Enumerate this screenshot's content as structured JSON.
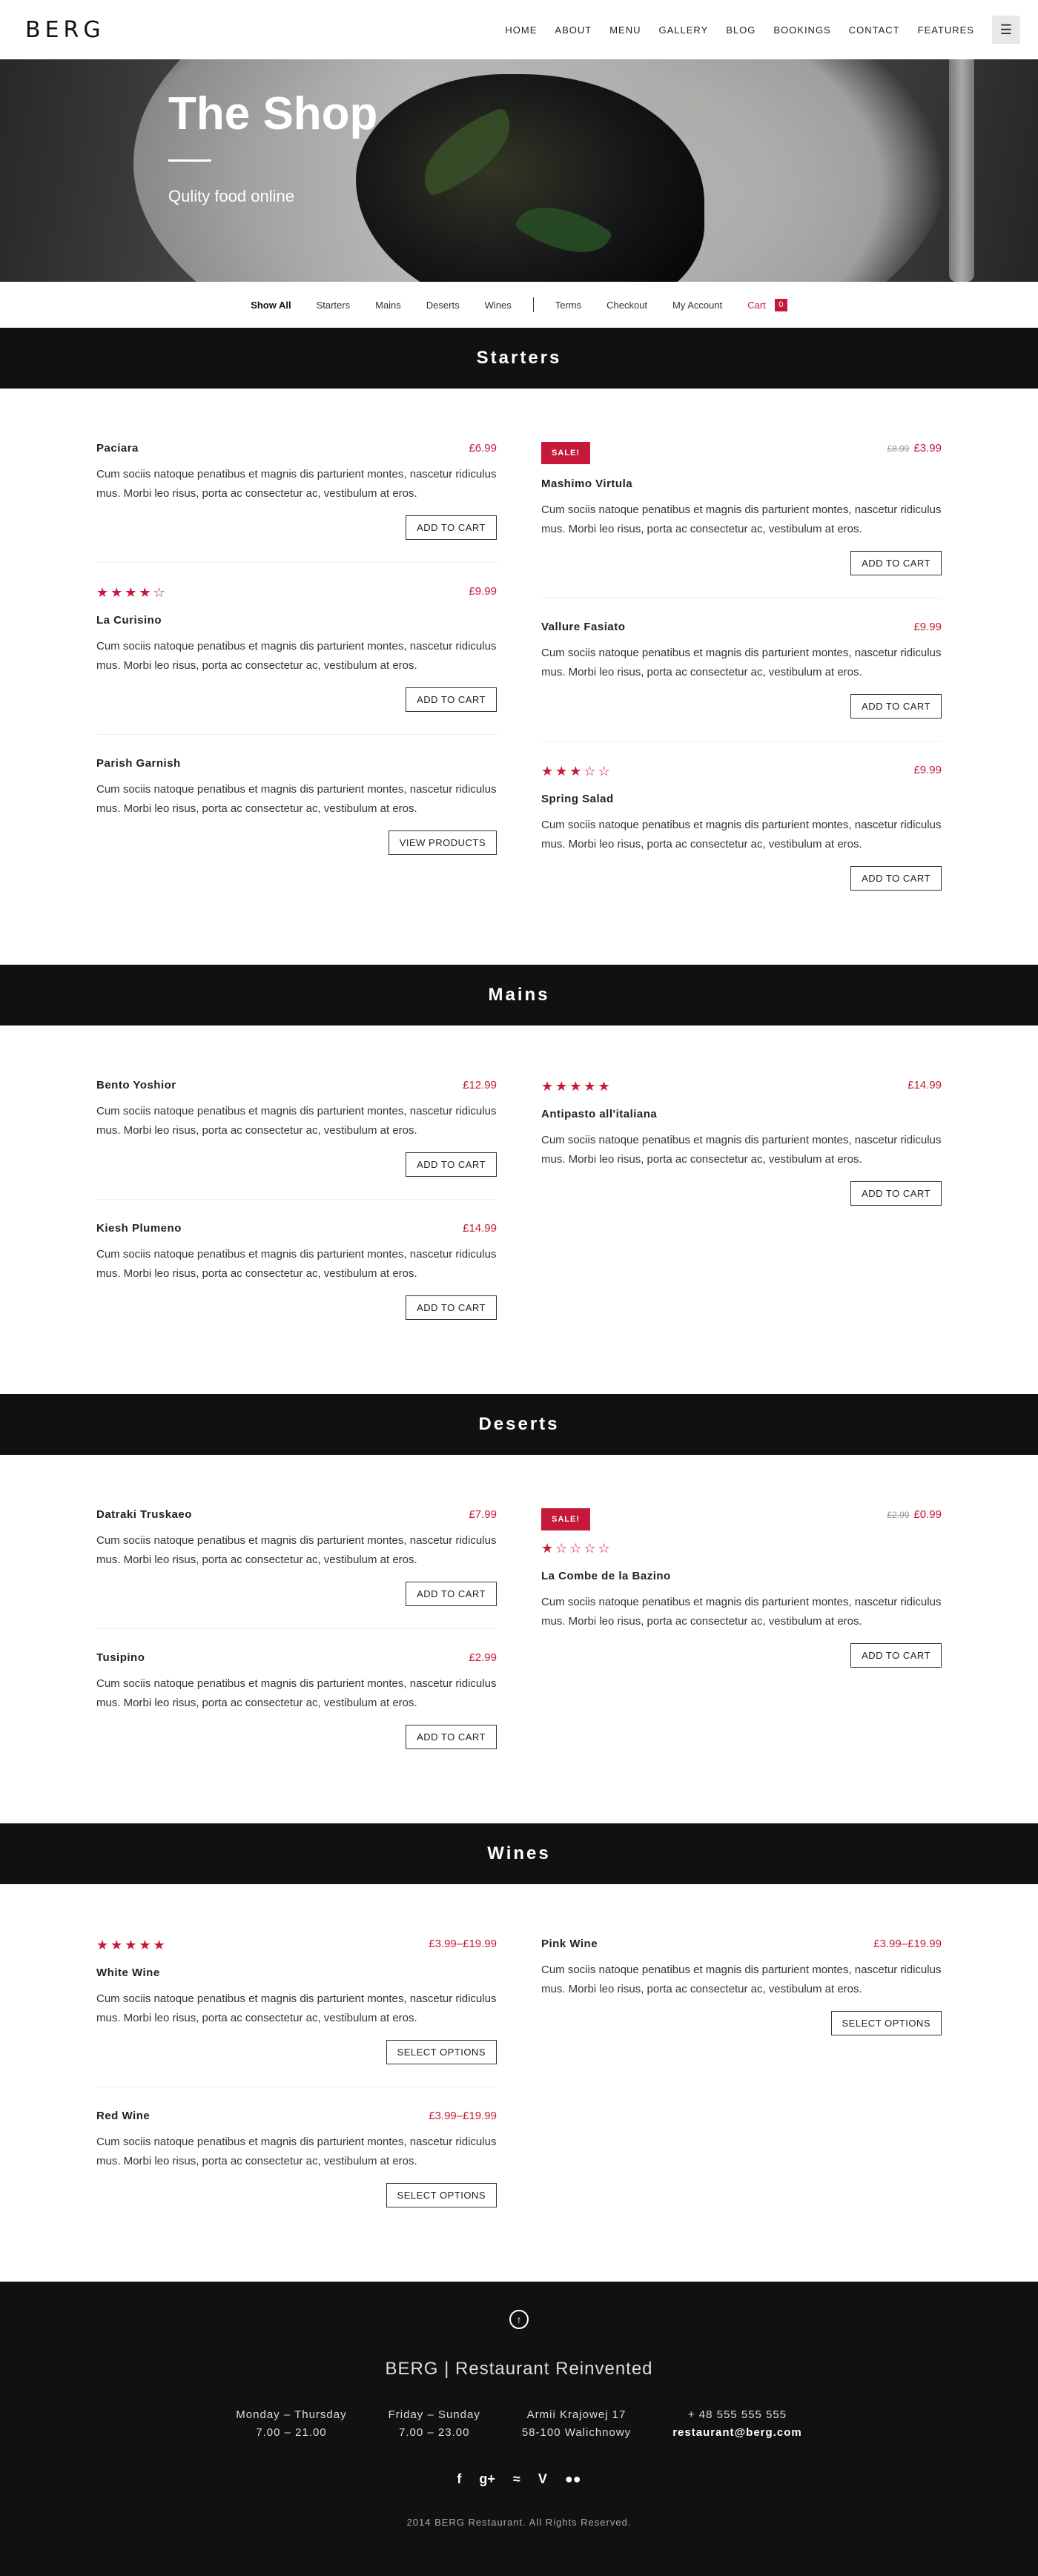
{
  "header": {
    "logo": "BERG",
    "nav": [
      "HOME",
      "ABOUT",
      "MENU",
      "GALLERY",
      "BLOG",
      "BOOKINGS",
      "CONTACT",
      "FEATURES"
    ],
    "menu_icon": "hamburger-icon"
  },
  "hero": {
    "title": "The Shop",
    "subtitle": "Qulity food online"
  },
  "filters": {
    "items": [
      "Show All",
      "Starters",
      "Mains",
      "Deserts",
      "Wines"
    ],
    "links": [
      "Terms",
      "Checkout",
      "My Account"
    ],
    "cart_label": "Cart",
    "cart_count": "0"
  },
  "desc": "Cum sociis natoque penatibus et magnis dis parturient montes, nascetur ridiculus mus. Morbi leo risus, porta ac consectetur ac, vestibulum at eros.",
  "sections": [
    {
      "title": "Starters",
      "left": [
        {
          "name": "Paciara",
          "price": "£6.99",
          "button": "ADD TO CART"
        },
        {
          "name": "La Curisino",
          "price": "£9.99",
          "stars": 4,
          "button": "ADD TO CART"
        },
        {
          "name": "Parish Garnish",
          "price": "",
          "button": "VIEW PRODUCTS"
        }
      ],
      "right": [
        {
          "name": "Mashimo Virtula",
          "sale": "SALE!",
          "old_price": "£8.99",
          "price": "£3.99",
          "button": "ADD TO CART"
        },
        {
          "name": "Vallure Fasiato",
          "price": "£9.99",
          "button": "ADD TO CART"
        },
        {
          "name": "Spring Salad",
          "price": "£9.99",
          "stars": 3,
          "button": "ADD TO CART"
        }
      ]
    },
    {
      "title": "Mains",
      "left": [
        {
          "name": "Bento Yoshior",
          "price": "£12.99",
          "button": "ADD TO CART"
        },
        {
          "name": "Kiesh Plumeno",
          "price": "£14.99",
          "button": "ADD TO CART"
        }
      ],
      "right": [
        {
          "name": "Antipasto all'italiana",
          "price": "£14.99",
          "stars": 5,
          "button": "ADD TO CART"
        }
      ]
    },
    {
      "title": "Deserts",
      "left": [
        {
          "name": "Datraki Truskaeo",
          "price": "£7.99",
          "button": "ADD TO CART"
        },
        {
          "name": "Tusipino",
          "price": "£2.99",
          "button": "ADD TO CART"
        }
      ],
      "right": [
        {
          "name": "La Combe de la Bazino",
          "sale": "SALE!",
          "old_price": "£2.99",
          "price": "£0.99",
          "stars": 1,
          "button": "ADD TO CART"
        }
      ]
    },
    {
      "title": "Wines",
      "left": [
        {
          "name": "White Wine",
          "price": "£3.99–£19.99",
          "stars": 5,
          "button": "SELECT OPTIONS"
        },
        {
          "name": "Red Wine",
          "price": "£3.99–£19.99",
          "button": "SELECT OPTIONS"
        }
      ],
      "right": [
        {
          "name": "Pink Wine",
          "price": "£3.99–£19.99",
          "button": "SELECT OPTIONS"
        }
      ]
    }
  ],
  "footer": {
    "title": "BERG | Restaurant Reinvented",
    "hours": [
      {
        "label": "Monday – Thursday",
        "value": "7.00 – 21.00"
      },
      {
        "label": "Friday – Sunday",
        "value": "7.00 – 23.00"
      }
    ],
    "address": [
      "Armii Krajowej 17",
      "58-100 Walichnowy"
    ],
    "contact": [
      "+ 48 555 555 555",
      "restaurant@berg.com"
    ],
    "socials": [
      "facebook-icon",
      "google-plus-icon",
      "spotify-icon",
      "vine-icon",
      "flickr-icon"
    ],
    "copyright": "2014 BERG Restaurant. All Rights Reserved."
  },
  "colors": {
    "accent": "#c6193a",
    "band": "#111111"
  }
}
